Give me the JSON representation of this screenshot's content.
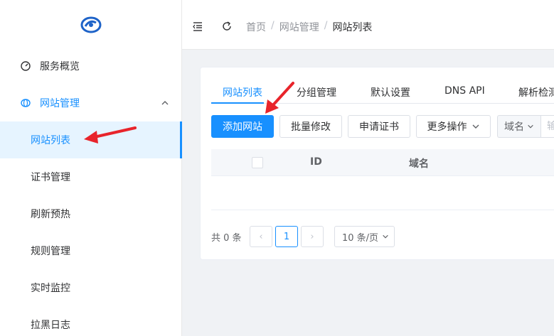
{
  "sidebar": {
    "items": [
      {
        "label": "服务概览",
        "icon": "dashboard-icon"
      },
      {
        "label": "网站管理",
        "icon": "globe-icon"
      },
      {
        "label": "网站列表"
      },
      {
        "label": "证书管理"
      },
      {
        "label": "刷新预热"
      },
      {
        "label": "规则管理"
      },
      {
        "label": "实时监控"
      },
      {
        "label": "拉黑日志"
      }
    ]
  },
  "header": {
    "breadcrumb": [
      "首页",
      "网站管理",
      "网站列表"
    ],
    "separator": "/"
  },
  "tabs": [
    "网站列表",
    "分组管理",
    "默认设置",
    "DNS API",
    "解析检测"
  ],
  "toolbar": {
    "add_site": "添加网站",
    "batch_edit": "批量修改",
    "apply_cert": "申请证书",
    "more_actions": "更多操作",
    "field_select": "域名",
    "search_placeholder": "输"
  },
  "table": {
    "columns": [
      "ID",
      "域名"
    ]
  },
  "pagination": {
    "total_text": "共 0 条",
    "prev": "‹",
    "current_page": "1",
    "next": "›",
    "page_size": "10 条/页"
  },
  "colors": {
    "accent": "#1890ff",
    "annotation": "#e8242b"
  }
}
